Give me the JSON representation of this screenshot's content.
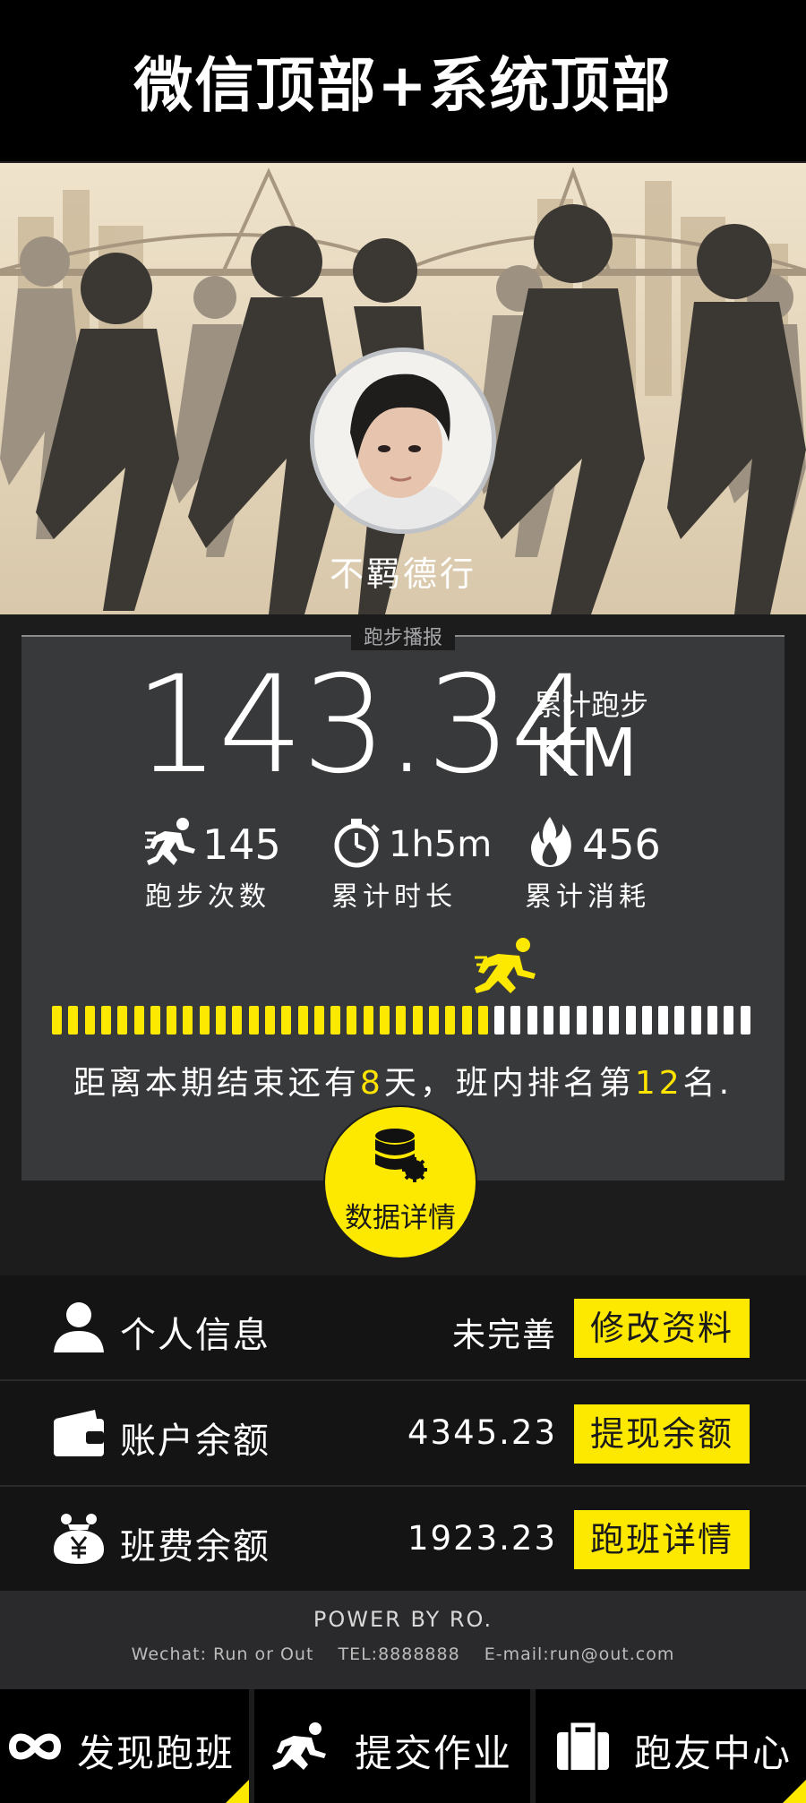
{
  "topbar": {
    "title": "微信顶部+系统顶部"
  },
  "profile": {
    "username": "不羁德行"
  },
  "board": {
    "header": "跑步播报",
    "total_distance": "143.34",
    "total_caption": "累计跑步",
    "total_unit": "KM",
    "stats": [
      {
        "icon": "runner-icon",
        "value": "145",
        "label": "跑步次数"
      },
      {
        "icon": "stopwatch-icon",
        "value": "1h5m",
        "label": "累计时长"
      },
      {
        "icon": "flame-icon",
        "value": "456",
        "label": "累计消耗"
      }
    ],
    "progress_fraction": 0.63,
    "remain_prefix": "距离本期结束还有",
    "remain_days": "8",
    "remain_mid": "天，班内排名第",
    "remain_rank": "12",
    "remain_suffix": "名.",
    "detail_button": "数据详情"
  },
  "rows": [
    {
      "icon": "user-icon",
      "label": "个人信息",
      "value": "未完善",
      "button": "修改资料"
    },
    {
      "icon": "wallet-icon",
      "label": "账户余额",
      "value": "4345.23",
      "button": "提现余额"
    },
    {
      "icon": "money-bag-icon",
      "label": "班费余额",
      "value": "1923.23",
      "button": "跑班详情"
    }
  ],
  "footer": {
    "power": "POWER BY RO.",
    "wechat": "Wechat: Run or Out",
    "tel": "TEL:8888888",
    "email": "E-mail:run@out.com"
  },
  "tabs": [
    {
      "icon": "infinity-icon",
      "label": "发现跑班"
    },
    {
      "icon": "runner-icon",
      "label": "提交作业"
    },
    {
      "icon": "briefcase-icon",
      "label": "跑友中心"
    }
  ],
  "colors": {
    "accent": "#fde800",
    "background": "#1c1c1d",
    "board": "#38393b"
  }
}
